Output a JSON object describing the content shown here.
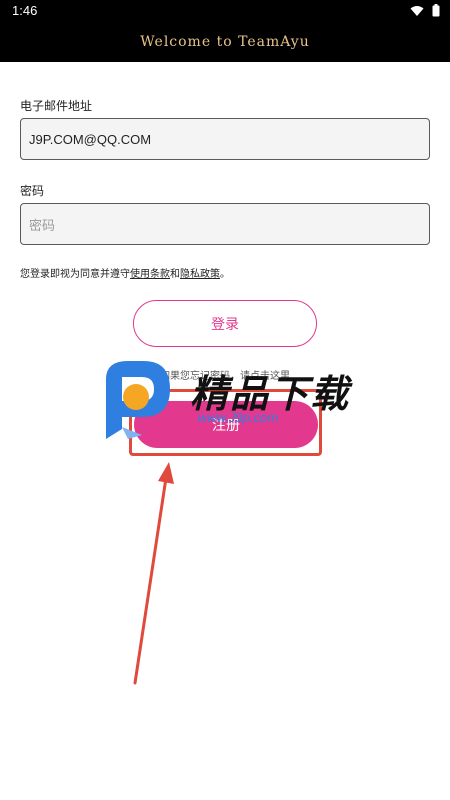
{
  "status_bar": {
    "time": "1:46"
  },
  "header": {
    "title": "Welcome to TeamAyu"
  },
  "form": {
    "email_label": "电子邮件地址",
    "email_value": "J9P.COM@QQ.COM",
    "password_label": "密码",
    "password_placeholder": "密码",
    "terms_prefix": "您登录即视为同意并遵守",
    "terms_link": "使用条款",
    "terms_and": "和",
    "privacy_link": "隐私政策",
    "terms_suffix": "。"
  },
  "login_button": "登录",
  "forgot_hint": "如果您忘记密码，请点击这里",
  "register_button": "注册",
  "watermark": {
    "text": "精品下载",
    "url": "www.J9p.com"
  },
  "colors": {
    "accent": "#e2398f",
    "header_bg": "#000000",
    "title": "#e9c48a",
    "annotation": "#e04a3c"
  }
}
